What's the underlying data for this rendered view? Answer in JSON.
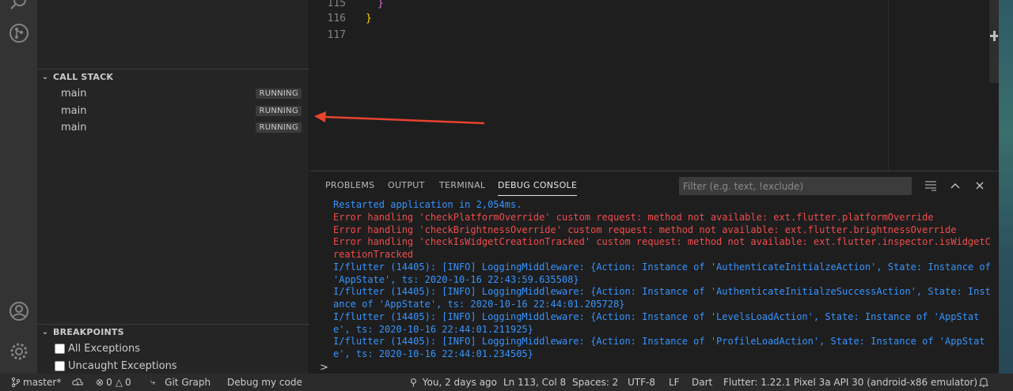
{
  "activity_bar": {
    "icons": [
      "search-icon",
      "source-control-icon",
      "account-icon",
      "settings-gear-icon"
    ]
  },
  "call_stack": {
    "title": "CALL STACK",
    "frames": [
      {
        "name": "main",
        "status": "RUNNING"
      },
      {
        "name": "main",
        "status": "RUNNING"
      },
      {
        "name": "main",
        "status": "RUNNING"
      }
    ]
  },
  "breakpoints": {
    "title": "BREAKPOINTS",
    "items": [
      {
        "label": "All Exceptions",
        "checked": false
      },
      {
        "label": "Uncaught Exceptions",
        "checked": false
      }
    ]
  },
  "editor": {
    "lines": [
      {
        "number": "115",
        "text": "}"
      },
      {
        "number": "116",
        "text": "}"
      },
      {
        "number": "117",
        "text": ""
      }
    ]
  },
  "panel": {
    "tabs": [
      "PROBLEMS",
      "OUTPUT",
      "TERMINAL",
      "DEBUG CONSOLE"
    ],
    "active_tab": "DEBUG CONSOLE",
    "filter_placeholder": "Filter (e.g. text, !exclude)",
    "console_lines": [
      {
        "kind": "out",
        "text": "Restarted application in 2,054ms."
      },
      {
        "kind": "err",
        "text": "Error handling 'checkPlatformOverride' custom request: method not available: ext.flutter.platformOverride"
      },
      {
        "kind": "err",
        "text": "Error handling 'checkBrightnessOverride' custom request: method not available: ext.flutter.brightnessOverride"
      },
      {
        "kind": "err",
        "text": "Error handling 'checkIsWidgetCreationTracked' custom request: method not available: ext.flutter.inspector.isWidgetCreationTracked"
      },
      {
        "kind": "out",
        "text": "I/flutter (14405): [INFO] LoggingMiddleware: {Action: Instance of 'AuthenticateInitialzeAction', State: Instance of 'AppState', ts: 2020-10-16 22:43:59.635508}"
      },
      {
        "kind": "out",
        "text": "I/flutter (14405): [INFO] LoggingMiddleware: {Action: Instance of 'AuthenticateInitialzeSuccessAction', State: Instance of 'AppState', ts: 2020-10-16 22:44:01.205728}"
      },
      {
        "kind": "out",
        "text": "I/flutter (14405): [INFO] LoggingMiddleware: {Action: Instance of 'LevelsLoadAction', State: Instance of 'AppState', ts: 2020-10-16 22:44:01.211925}"
      },
      {
        "kind": "out",
        "text": "I/flutter (14405): [INFO] LoggingMiddleware: {Action: Instance of 'ProfileLoadAction', State: Instance of 'AppState', ts: 2020-10-16 22:44:01.234505}"
      }
    ],
    "prompt": ">"
  },
  "status_bar": {
    "branch": "master*",
    "errors": "0",
    "warnings": "0",
    "git_graph": "Git Graph",
    "debug_config": "Debug my code",
    "blame": "You, 2 days ago",
    "position": "Ln 113, Col 8",
    "spaces": "Spaces: 2",
    "encoding": "UTF-8",
    "eol": "LF",
    "language": "Dart",
    "flutter": "Flutter: 1.22.1",
    "device": "Pixel 3a API 30 (android-x86 emulator)"
  },
  "colors": {
    "annotation_arrow": "#e8432f",
    "console_info": "#3794ff",
    "console_error": "#f14c4c",
    "bracket": "#ffd700"
  }
}
